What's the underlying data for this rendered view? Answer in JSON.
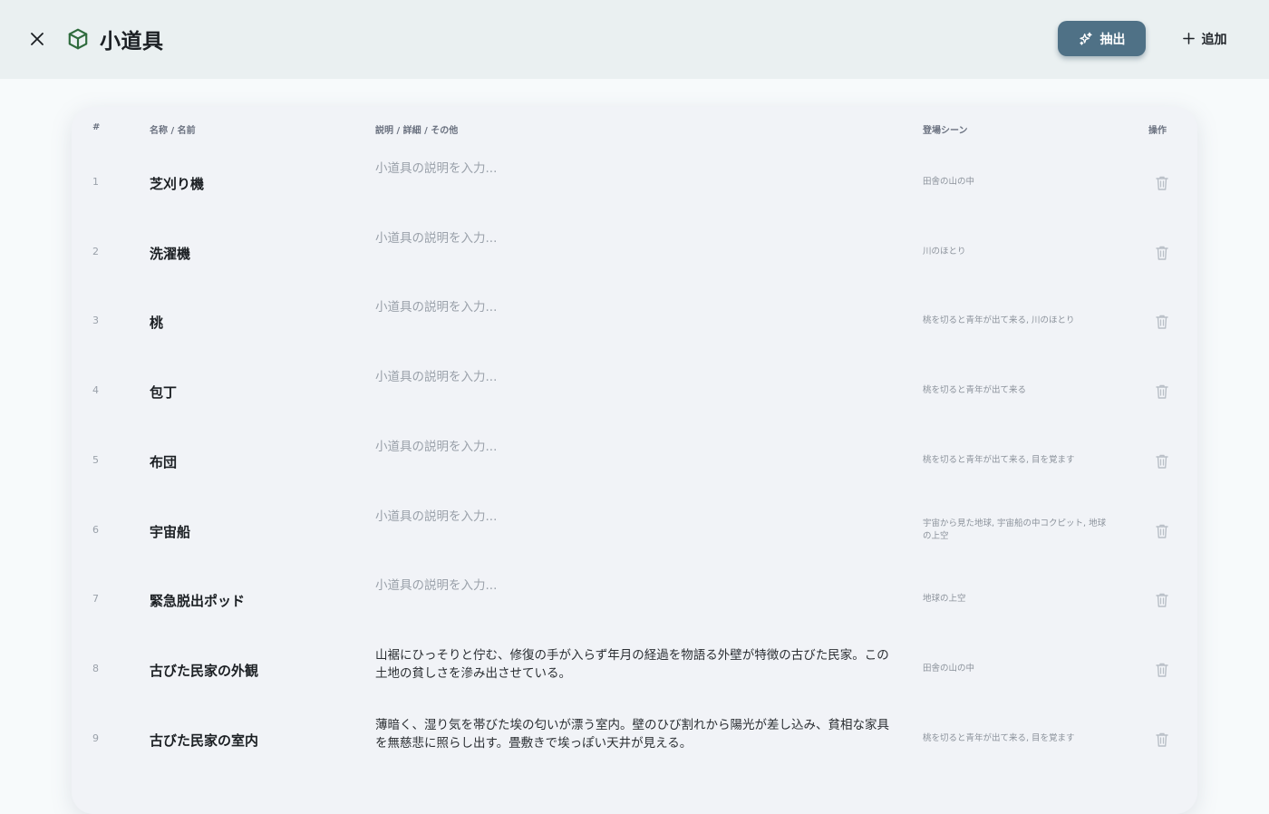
{
  "header": {
    "title": "小道具",
    "title_icon": "cube-icon",
    "close_icon": "close-icon",
    "extract_label": "抽出",
    "extract_icon": "sparkles-icon",
    "add_label": "追加",
    "add_icon": "plus-icon",
    "colors": {
      "accent": "#4f7186",
      "brand_icon": "#2f6b3d"
    }
  },
  "table": {
    "columns": {
      "num": "#",
      "name": "名称 / 名前",
      "desc": "説明 / 詳細 / その他",
      "scene": "登場シーン",
      "action": "操作"
    },
    "desc_placeholder": "小道具の説明を入力...",
    "delete_icon": "trash-icon",
    "rows": [
      {
        "num": "1",
        "name": "芝刈り機",
        "desc": "",
        "scene": "田舎の山の中"
      },
      {
        "num": "2",
        "name": "洗濯機",
        "desc": "",
        "scene": "川のほとり"
      },
      {
        "num": "3",
        "name": "桃",
        "desc": "",
        "scene": "桃を切ると青年が出て来る, 川のほとり"
      },
      {
        "num": "4",
        "name": "包丁",
        "desc": "",
        "scene": "桃を切ると青年が出て来る"
      },
      {
        "num": "5",
        "name": "布団",
        "desc": "",
        "scene": "桃を切ると青年が出て来る, 目を覚ます"
      },
      {
        "num": "6",
        "name": "宇宙船",
        "desc": "",
        "scene": "宇宙から見た地球, 宇宙船の中コクピット, 地球の上空"
      },
      {
        "num": "7",
        "name": "緊急脱出ポッド",
        "desc": "",
        "scene": "地球の上空"
      },
      {
        "num": "8",
        "name": "古びた民家の外観",
        "desc": "山裾にひっそりと佇む、修復の手が入らず年月の経過を物語る外壁が特徴の古びた民家。この土地の貧しさを滲み出させている。",
        "scene": "田舎の山の中"
      },
      {
        "num": "9",
        "name": "古びた民家の室内",
        "desc": "薄暗く、湿り気を帯びた埃の匂いが漂う室内。壁のひび割れから陽光が差し込み、貧相な家具を無慈悲に照らし出す。畳敷きで埃っぽい天井が見える。",
        "scene": "桃を切ると青年が出て来る, 目を覚ます"
      }
    ]
  }
}
